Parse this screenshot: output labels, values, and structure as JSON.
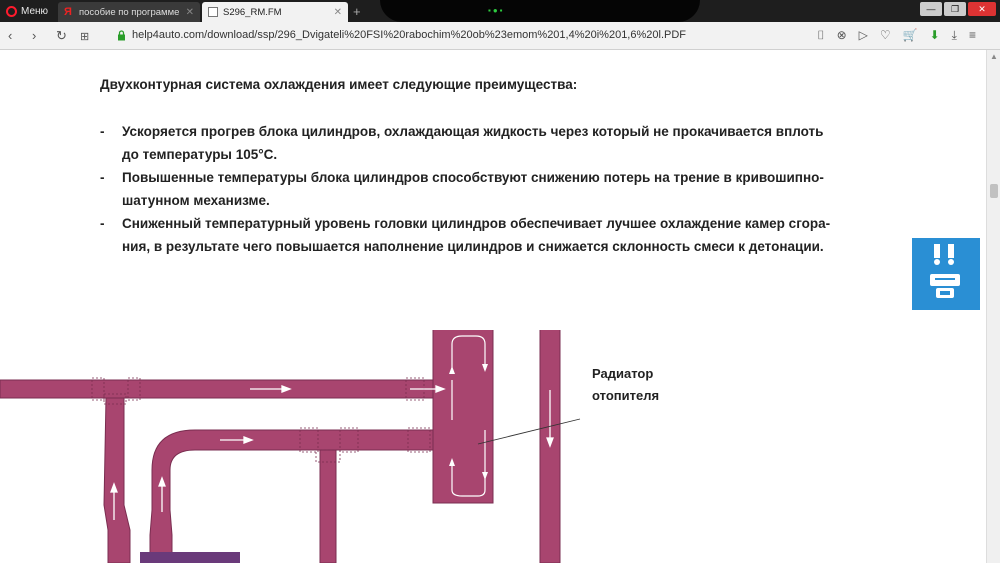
{
  "browser": {
    "menu_label": "Меню",
    "tabs": [
      {
        "title": "пособие по программе сб",
        "active": false
      },
      {
        "title": "S296_RM.FM",
        "active": true
      }
    ],
    "new_tab": "+",
    "url": "help4auto.com/download/ssp/296_Dvigateli%20FSI%20rabochim%20ob%23emom%201,4%20i%201,6%20l.PDF"
  },
  "document": {
    "heading": "Двухконтурная система охлаждения имеет следующие преимущества:",
    "bullets": [
      {
        "dash": "-",
        "line1": "Ускоряется прогрев блока цилиндров, охлаждающая жидкость через который не прокачивается вплоть",
        "line2": "до температуры 105°С."
      },
      {
        "dash": "-",
        "line1": "Повышенные температуры блока цилиндров способствуют снижению потерь на трение в кривошипно-",
        "line2": "шатунном механизме."
      },
      {
        "dash": "-",
        "line1": "Сниженный температурный уровень головки цилиндров обеспечивает лучшее охлаждение камер сгора-",
        "line2": "ния, в результате чего повышается наполнение цилиндров и снижается склонность смеси к детонации."
      }
    ],
    "diagram": {
      "radiator_label_line1": "Радиатор",
      "radiator_label_line2": "отопителя"
    }
  },
  "colors": {
    "pipe": "#a8456f",
    "pipe_dark": "#7a2d50",
    "widget": "#2a8fd4",
    "engine": "#6a3a7a"
  },
  "icons": [
    "opera-logo",
    "yandex-icon",
    "document-icon",
    "back-icon",
    "forward-icon",
    "reload-icon",
    "speed-dial-icon",
    "lock-icon",
    "camera-icon",
    "adblock-icon",
    "share-icon",
    "heart-icon",
    "cart-icon",
    "download-icon",
    "menu-icon"
  ]
}
